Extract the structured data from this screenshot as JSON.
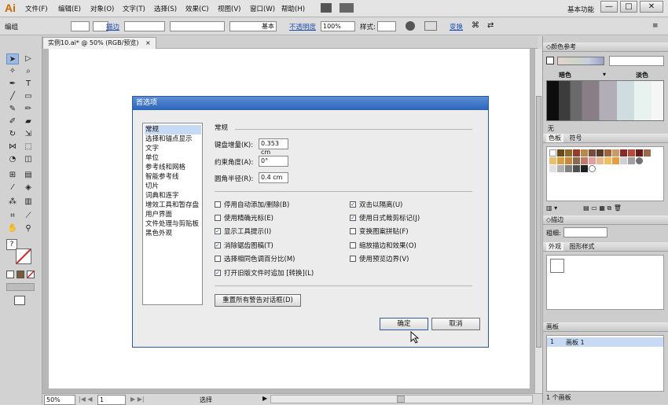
{
  "app": {
    "logo": "Ai",
    "workspace": "基本功能"
  },
  "menu": [
    "文件(F)",
    "编辑(E)",
    "对象(O)",
    "文字(T)",
    "选择(S)",
    "效果(C)",
    "视图(V)",
    "窗口(W)",
    "帮助(H)"
  ],
  "window_buttons": {
    "minimize": "—",
    "restore": "□",
    "close": "✕"
  },
  "control": {
    "left_label": "编组",
    "stroke_link": "描边",
    "line_style": "基本",
    "opacity_link": "不透明度",
    "opacity_value": "100%",
    "style_label": "样式:",
    "transform_link": "变换"
  },
  "doc_tab": {
    "title": "实例10.ai* @ 50% (RGB/预览)",
    "close": "×"
  },
  "status": {
    "zoom": "50%",
    "page": "1",
    "mode": "选择"
  },
  "panels": {
    "color_ref": {
      "title": "颜色参考",
      "dark": "暗色",
      "light": "淡色",
      "none_label": "无"
    },
    "swatches": {
      "tab1": "色板",
      "tab2": "符号"
    },
    "stroke": {
      "title": "描边",
      "weight_label": "粗细:"
    },
    "appearance": {
      "tab1": "外观",
      "tab2": "图形样式"
    },
    "artboards": {
      "title": "画板",
      "row_num": "1",
      "row_name": "画板 1",
      "footer": "1 个画板"
    }
  },
  "dialog": {
    "title": "首选项",
    "nav": [
      "常规",
      "选择和锚点显示",
      "文字",
      "单位",
      "参考线和网格",
      "智能参考线",
      "切片",
      "词典和连字",
      "增效工具和暂存盘",
      "用户界面",
      "文件处理与剪贴板",
      "黑色外观"
    ],
    "section": "常规",
    "fields": [
      {
        "label": "键盘增量(K):",
        "value": "0.353 cm"
      },
      {
        "label": "约束角度(A):",
        "value": "0°"
      },
      {
        "label": "圆角半径(R):",
        "value": "0.4 cm"
      }
    ],
    "options_left": [
      {
        "label": "停用自动添加/删除(B)",
        "checked": false
      },
      {
        "label": "使用精确光标(E)",
        "checked": false
      },
      {
        "label": "显示工具提示(I)",
        "checked": true
      },
      {
        "label": "消除锯齿图稿(T)",
        "checked": true
      },
      {
        "label": "选择相同色调百分比(M)",
        "checked": false
      },
      {
        "label": "打开旧版文件时追加 [转换](L)",
        "checked": true
      }
    ],
    "options_right": [
      {
        "label": "双击以隔离(U)",
        "checked": true
      },
      {
        "label": "使用日式裁剪标记(J)",
        "checked": true
      },
      {
        "label": "变换图案拼贴(F)",
        "checked": false
      },
      {
        "label": "缩放描边和效果(O)",
        "checked": false
      },
      {
        "label": "使用预览边界(V)",
        "checked": false
      }
    ],
    "reset_button": "重置所有警告对话框(D)",
    "ok": "确定",
    "cancel": "取消"
  },
  "colors": {
    "accent": "#2c64b8",
    "check": "#1a4f9c"
  }
}
